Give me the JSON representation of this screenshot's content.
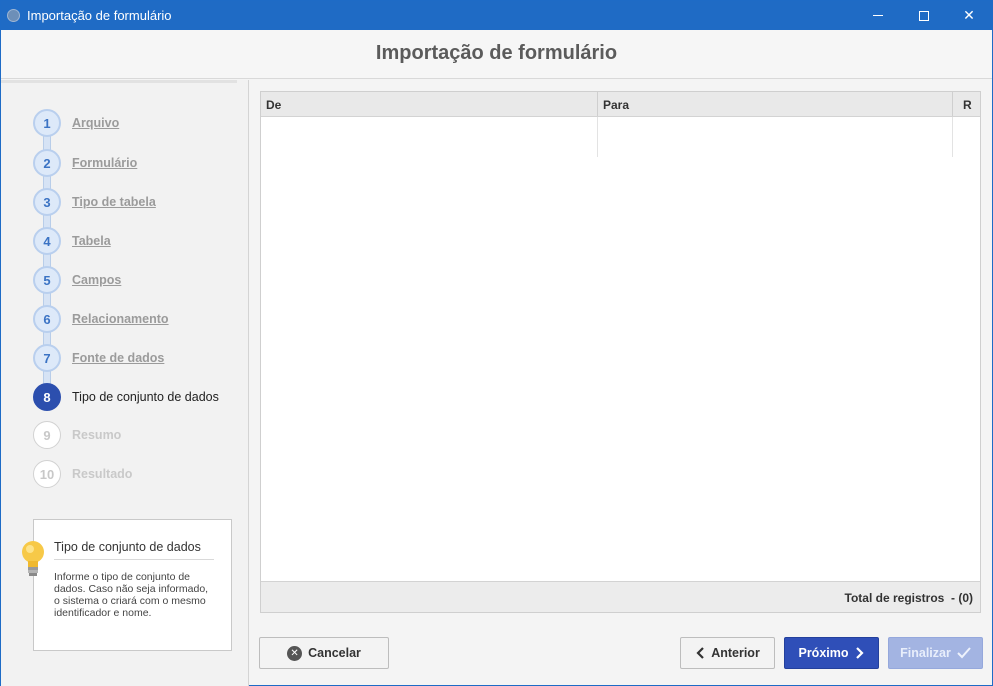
{
  "window": {
    "title": "Importação de formulário",
    "close_symbol": "✕"
  },
  "header": {
    "title": "Importação de formulário"
  },
  "steps": [
    {
      "num": "1",
      "label": "Arquivo",
      "state": "done"
    },
    {
      "num": "2",
      "label": "Formulário",
      "state": "done"
    },
    {
      "num": "3",
      "label": "Tipo de tabela",
      "state": "done"
    },
    {
      "num": "4",
      "label": "Tabela",
      "state": "done"
    },
    {
      "num": "5",
      "label": "Campos",
      "state": "done"
    },
    {
      "num": "6",
      "label": "Relacionamento",
      "state": "done"
    },
    {
      "num": "7",
      "label": "Fonte de dados",
      "state": "done"
    },
    {
      "num": "8",
      "label": "Tipo de conjunto de dados",
      "state": "active"
    },
    {
      "num": "9",
      "label": "Resumo",
      "state": "todo"
    },
    {
      "num": "10",
      "label": "Resultado",
      "state": "todo"
    }
  ],
  "help": {
    "title": "Tipo de conjunto de dados",
    "text": "Informe o tipo de conjunto de dados. Caso não seja informado, o sistema o criará com o mesmo identificador e nome."
  },
  "grid": {
    "columns": [
      "De",
      "Para",
      "R"
    ],
    "rows": [],
    "total_label": "Total de registros",
    "total_value": "- (0)"
  },
  "buttons": {
    "cancel": "Cancelar",
    "previous": "Anterior",
    "next": "Próximo",
    "finish": "Finalizar"
  },
  "colors": {
    "titlebar": "#1f6bc5",
    "active_step": "#2c4fae",
    "next_button": "#2f4fb8",
    "finish_button_disabled": "#a3b4e2"
  }
}
